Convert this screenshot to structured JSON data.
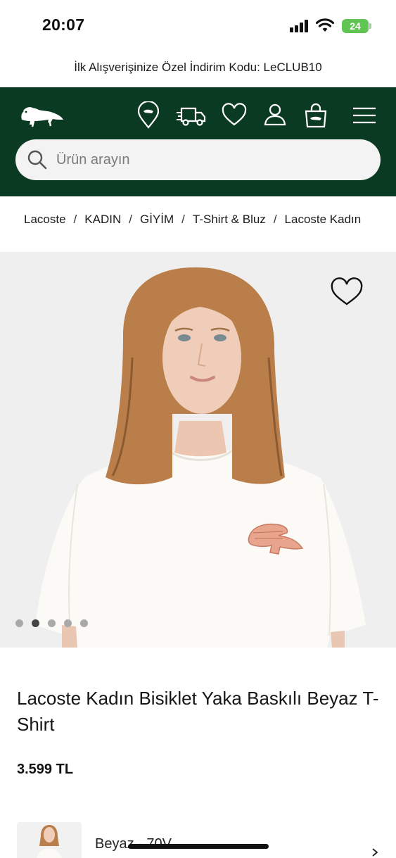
{
  "status_bar": {
    "time": "20:07",
    "battery": "24"
  },
  "promo": {
    "text": "İlk Alışverişinize Özel İndirim Kodu: LeCLUB10"
  },
  "search": {
    "placeholder": "Ürün arayın"
  },
  "breadcrumb": [
    "Lacoste",
    "KADIN",
    "GİYİM",
    "T-Shirt & Bluz",
    "Lacoste Kadın"
  ],
  "product": {
    "title": "Lacoste Kadın Bisiklet Yaka Baskılı Beyaz T-Shirt",
    "price": "3.599 TL",
    "variant_label": "Beyaz - 70V",
    "gallery_active_dot": 2,
    "gallery_dot_count": 5
  },
  "colors": {
    "header_green": "#0b3a22",
    "logo_color": "#ffffff"
  },
  "icons": [
    "lacoste-logo-icon",
    "store-location-icon",
    "delivery-truck-icon",
    "heart-icon",
    "user-icon",
    "shopping-bag-icon",
    "hamburger-menu-icon",
    "search-icon",
    "wishlist-heart-icon",
    "chevron-right-icon"
  ]
}
